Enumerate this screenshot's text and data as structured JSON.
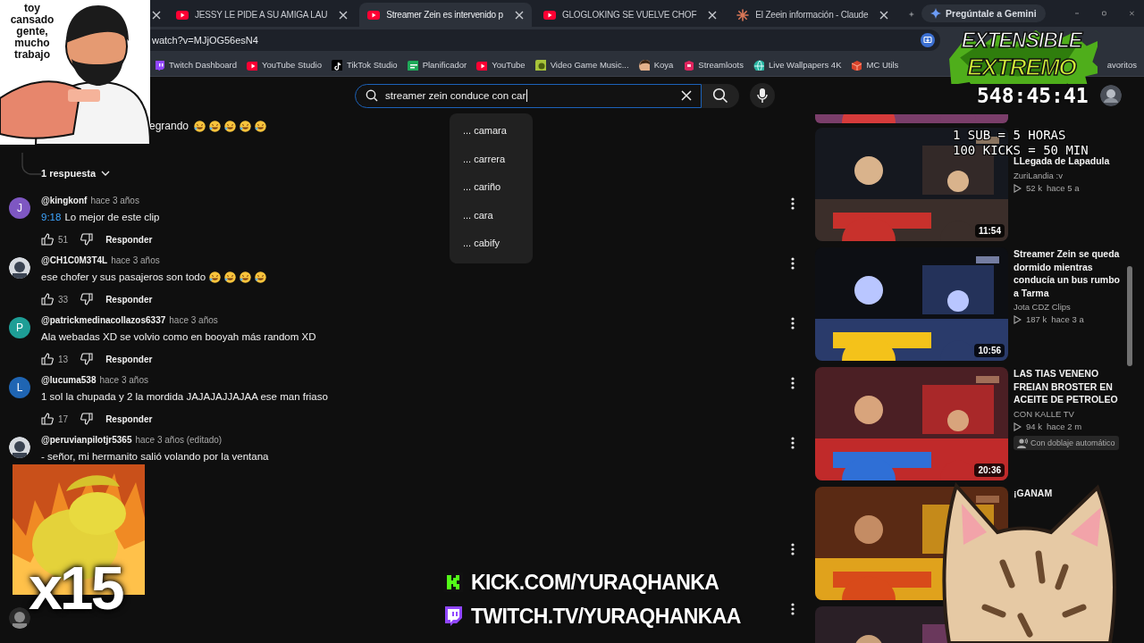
{
  "browser": {
    "tabs": [
      {
        "kind": "cut",
        "selected": false
      },
      {
        "kind": "youtube",
        "title": "JESSY LE PIDE A SU AMIGA LAU",
        "selected": false
      },
      {
        "kind": "youtube",
        "title": "Streamer Zein es intervenido p",
        "selected": true
      },
      {
        "kind": "youtube",
        "title": "GLOGLOKING SE VUELVE CHOF",
        "selected": false
      },
      {
        "kind": "claude",
        "title": "El Zeein información - Claude",
        "selected": false
      }
    ],
    "gemini_button": "Pregúntale a Gemini",
    "address": "watch?v=MJjOG56esN4",
    "bookmarks": [
      {
        "kind": "twitch",
        "label": "Twitch Dashboard"
      },
      {
        "kind": "youtube",
        "label": "YouTube Studio"
      },
      {
        "kind": "tiktok",
        "label": "TikTok Studio"
      },
      {
        "kind": "planner",
        "label": "Planificador"
      },
      {
        "kind": "youtube",
        "label": "YouTube"
      },
      {
        "kind": "game",
        "label": "Video Game Music..."
      },
      {
        "kind": "person",
        "label": "Koya"
      },
      {
        "kind": "loot",
        "label": "Streamloots"
      },
      {
        "kind": "wallpaper",
        "label": "Live Wallpapers 4K"
      },
      {
        "kind": "cube",
        "label": "MC Utils"
      },
      {
        "kind": "folder",
        "label": "avoritos"
      }
    ]
  },
  "youtube": {
    "search": {
      "value": "streamer zein conduce con car",
      "suggestions": [
        "... camara",
        "... carrera",
        "... cariño",
        "... cara",
        "... cabify"
      ]
    },
    "thread_top": {
      "text": "egrando",
      "reactions": [
        {
          "kind": "laughing"
        },
        {
          "kind": "laughing"
        },
        {
          "kind": "laughing"
        },
        {
          "kind": "laughing"
        },
        {
          "kind": "laughing"
        }
      ],
      "replies_toggle": "1 respuesta"
    },
    "comments": [
      {
        "kind": "full",
        "avatar": {
          "kind": "letter",
          "letter": "J",
          "color": "#7e57c2"
        },
        "author": "@kingkonf",
        "time": "hace 3 años",
        "timestamp": "9:18",
        "text": "Lo mejor de este clip",
        "likes": "51",
        "reply": "Responder"
      },
      {
        "kind": "full",
        "avatar": {
          "kind": "picture"
        },
        "author": "@CH1C0M3T4L",
        "time": "hace 3 años",
        "text": "ese chofer y sus pasajeros son todo",
        "reactions": [
          {
            "kind": "laughing"
          },
          {
            "kind": "laughing"
          },
          {
            "kind": "laughing"
          },
          {
            "kind": "laughing"
          }
        ],
        "likes": "33",
        "reply": "Responder"
      },
      {
        "kind": "full",
        "avatar": {
          "kind": "letter",
          "letter": "P",
          "color": "#1e9e96"
        },
        "author": "@patrickmedinacollazos6337",
        "time": "hace 3 años",
        "text": "Ala webadas XD se volvio como en booyah más random XD",
        "likes": "13",
        "reply": "Responder"
      },
      {
        "kind": "full",
        "avatar": {
          "kind": "letter",
          "letter": "L",
          "color": "#1f65b3"
        },
        "author": "@lucuma538",
        "time": "hace 3 años",
        "text": "1 sol la chupada y 2 la mordida JAJAJAJJAJAA ese man friaso",
        "likes": "17",
        "reply": "Responder"
      },
      {
        "kind": "covered_top",
        "avatar": {
          "kind": "picture"
        },
        "author": "@peruvianpilotjr5365",
        "time": "hace 3 años (editado)",
        "text": "- señor, mi hermanito salió volando por la ventana"
      },
      {
        "kind": "covered"
      },
      {
        "kind": "covered",
        "avatar": {
          "kind": "picture"
        }
      }
    ],
    "videos": [
      {
        "kind": "covered_title",
        "title": "LLegada de Lapadula",
        "channel": "ZuriLandia :v",
        "views": "52 k",
        "age": "hace 5 a",
        "duration": "11:54"
      },
      {
        "kind": "full",
        "title": "Streamer Zein se queda dormido mientras conducía un bus rumbo a Tarma",
        "channel": "Jota CDZ Clips",
        "views": "187 k",
        "age": "hace 3 a",
        "duration": "10:56"
      },
      {
        "kind": "full",
        "title": "LAS TIAS VENENO FREIAN BROSTER EN ACEITE DE PETROLEO",
        "channel": "CON KALLE TV",
        "views": "94 k",
        "age": "hace 2 m",
        "badge": "Con doblaje automático",
        "duration": "20:36"
      },
      {
        "kind": "full",
        "title": "¡GANAM"
      },
      {
        "kind": "thumb_only"
      }
    ]
  },
  "overlay": {
    "caption": "toy cansado gente, mucho trabajo",
    "logo": [
      "EXTENSIBLE",
      "EXTREMO"
    ],
    "timer": "548:45:41",
    "rules": [
      "1 SUB = 5 HORAS",
      "100 KICKS = 50 MIN"
    ],
    "multiplier": "x15",
    "links": [
      {
        "kind": "kick",
        "text": "KICK.COM/YURAQHANKA"
      },
      {
        "kind": "twitch",
        "text": "TWITCH.TV/YURAQHANKAA"
      }
    ]
  }
}
